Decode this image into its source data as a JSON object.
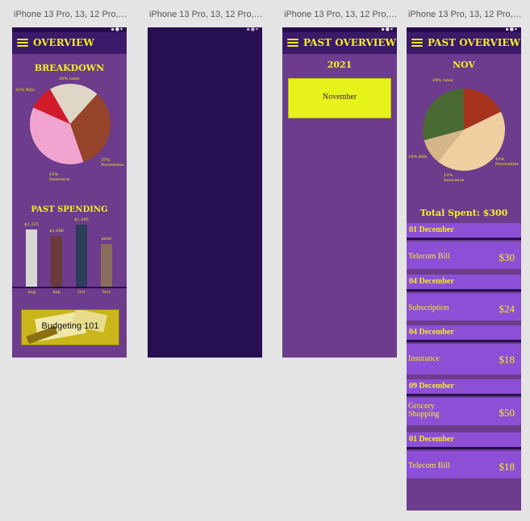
{
  "artboards": [
    {
      "label": "iPhone 13 Pro, 13, 12 Pro, 1..."
    },
    {
      "label": "iPhone 13 Pro, 13, 12 Pro, 1..."
    },
    {
      "label": "iPhone 13 Pro, 13, 12 Pro, 1..."
    },
    {
      "label": "iPhone 13 Pro, 13, 12 Pro, 1..."
    }
  ],
  "status_icons": "▪●▾",
  "overview": {
    "title": "OVERVIEW",
    "breakdown_heading": "BREAKDOWN",
    "pie_labels": {
      "rates": "20% rates",
      "bills": "33% Bills",
      "necessities": "37% Necessities",
      "insurance": "10% Insurance"
    },
    "spending_heading": "PAST SPENDING",
    "promo_text": "Budgeting 101"
  },
  "past_overview": {
    "title": "PAST OVERVIEW",
    "year": "2021",
    "month_card": "November"
  },
  "nov_detail": {
    "title": "PAST OVERVIEW",
    "month": "NOV",
    "pie_labels": {
      "rates": "29% rates",
      "bills": "18% Bills",
      "necessities": "43% Necessities",
      "insurance": "10% Insurance"
    },
    "total_spent": "Total Spent: $300",
    "transactions": [
      {
        "date": "01 December",
        "name": "Telecom Bill",
        "amount": "$30"
      },
      {
        "date": "04 December",
        "name": "Subscription",
        "amount": "$24"
      },
      {
        "date": "04 December",
        "name": "Insurance",
        "amount": "$18"
      },
      {
        "date": "09 December",
        "name": "Grocery Shopping",
        "amount": "$50"
      },
      {
        "date": "01 December",
        "name": "Telecom Bill",
        "amount": "$18"
      }
    ]
  },
  "chart_data": [
    {
      "type": "pie",
      "labels": [
        "rates",
        "Bills",
        "Necessities",
        "Insurance"
      ],
      "values": [
        20,
        33,
        37,
        10
      ]
    },
    {
      "type": "bar",
      "categories": [
        "Aug",
        "Sep",
        "Oct",
        "Nov"
      ],
      "values": [
        1235,
        1096,
        1345,
        920
      ],
      "value_labels": [
        "$1,235",
        "$1,096",
        "$1,345",
        "$920"
      ],
      "colors": [
        "#d8d8d2",
        "#6b3a3a",
        "#2c3d5a",
        "#8a6c5c"
      ]
    },
    {
      "type": "pie",
      "labels": [
        "rates",
        "Bills",
        "Necessities",
        "Insurance"
      ],
      "values": [
        29,
        18,
        43,
        10
      ]
    }
  ]
}
